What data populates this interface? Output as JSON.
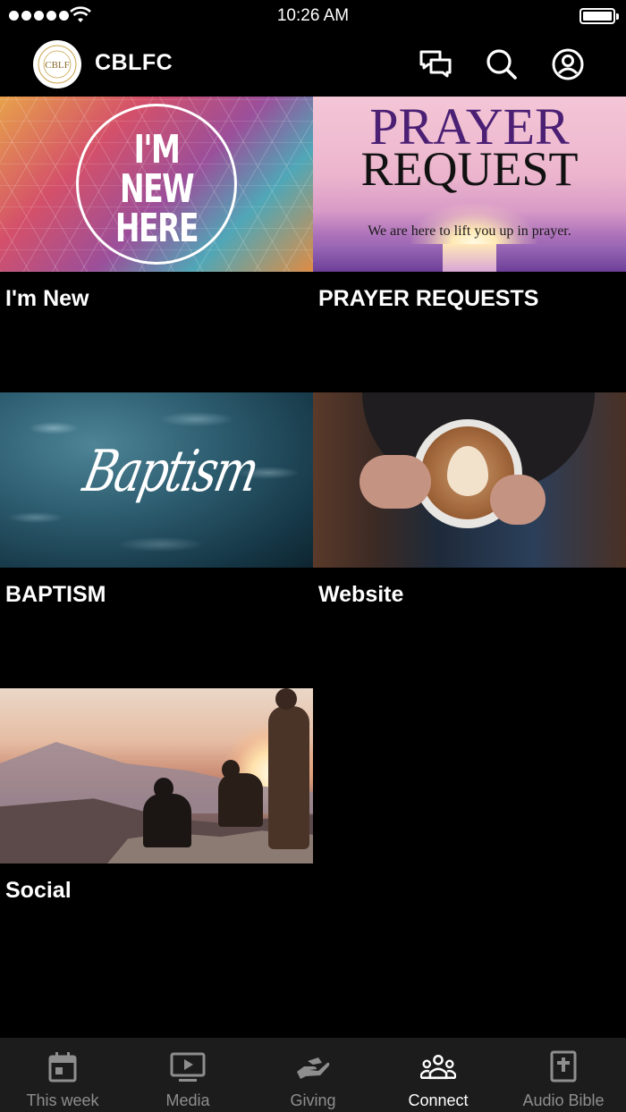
{
  "status_bar": {
    "time": "10:26 AM"
  },
  "header": {
    "title": "CBLFC",
    "logo_monogram": "CBLF",
    "icons": [
      "chat-icon",
      "search-icon",
      "account-icon"
    ]
  },
  "cards": [
    {
      "label": "I'm New",
      "artwork_text": [
        "I'M",
        "NEW",
        "HERE"
      ]
    },
    {
      "label": "PRAYER REQUESTS",
      "artwork_text": [
        "PRAYER",
        "REQUEST",
        "We are here to lift you up in prayer."
      ]
    },
    {
      "label": "BAPTISM",
      "artwork_text": [
        "Baptism"
      ]
    },
    {
      "label": "Website"
    },
    {
      "label": "Social"
    }
  ],
  "tab_bar": {
    "tabs": [
      {
        "label": "This week",
        "icon": "calendar-icon",
        "active": false
      },
      {
        "label": "Media",
        "icon": "play-screen-icon",
        "active": false
      },
      {
        "label": "Giving",
        "icon": "giving-hand-icon",
        "active": false
      },
      {
        "label": "Connect",
        "icon": "people-icon",
        "active": true
      },
      {
        "label": "Audio Bible",
        "icon": "bible-icon",
        "active": false
      }
    ]
  },
  "colors": {
    "background": "#000000",
    "tab_bar_bg": "#1c1c1c",
    "tab_inactive": "#8e8e8e",
    "tab_active": "#ffffff"
  }
}
